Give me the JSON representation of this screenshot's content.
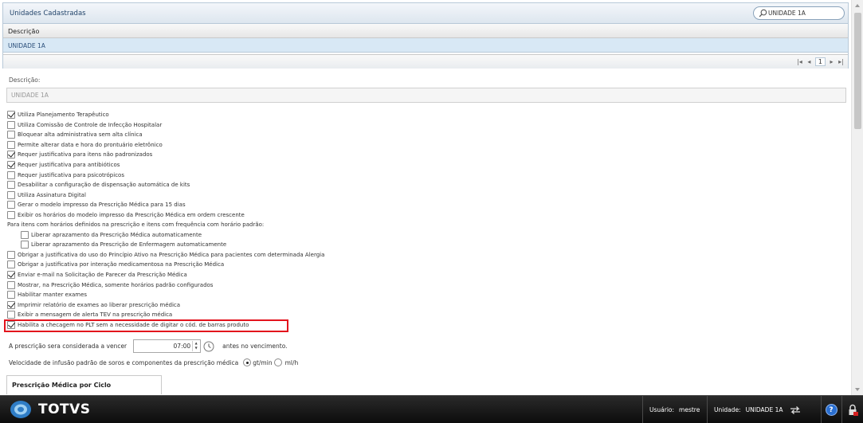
{
  "panel": {
    "title": "Unidades Cadastradas",
    "search_value": "UNIDADE 1A",
    "column_header": "Descrição",
    "rows": [
      "UNIDADE 1A"
    ],
    "pager": {
      "first": "|◂",
      "prev": "◂",
      "page": "1",
      "next": "▸",
      "last": "▸|"
    }
  },
  "form": {
    "descricao_label": "Descrição:",
    "descricao_value": "UNIDADE 1A",
    "options": [
      {
        "label": "Utiliza Planejamento Terapêutico",
        "checked": true
      },
      {
        "label": "Utiliza Comissão de Controle de Infecção Hospitalar",
        "checked": false
      },
      {
        "label": "Bloquear alta administrativa sem alta clínica",
        "checked": false
      },
      {
        "label": "Permite alterar data e hora do prontuário eletrônico",
        "checked": false
      },
      {
        "label": "Requer justificativa para itens não padronizados",
        "checked": true
      },
      {
        "label": "Requer justificativa para antibióticos",
        "checked": true
      },
      {
        "label": "Requer justificativa para psicotrópicos",
        "checked": false
      },
      {
        "label": "Desabilitar a configuração de dispensação automática de kits",
        "checked": false
      },
      {
        "label": "Utiliza Assinatura Digital",
        "checked": false
      },
      {
        "label": "Gerar o modelo impresso da Prescrição Médica para 15 dias",
        "checked": false
      },
      {
        "label": "Exibir os horários do modelo impresso da Prescrição Médica em ordem crescente",
        "checked": false
      },
      {
        "label": "Para itens com horários definidos na prescrição e itens com frequência com horário padrão:",
        "type": "text"
      },
      {
        "label": "Liberar aprazamento da Prescrição Médica automaticamente",
        "checked": false,
        "indent": true
      },
      {
        "label": "Liberar aprazamento da Prescrição de Enfermagem automaticamente",
        "checked": false,
        "indent": true
      },
      {
        "label": "Obrigar a justificativa do uso do Princípio Ativo na Prescrição Médica para pacientes com determinada Alergia",
        "checked": false
      },
      {
        "label": "Obrigar a justificativa por interação medicamentosa na Prescrição Médica",
        "checked": false
      },
      {
        "label": "Enviar e-mail na Solicitação de Parecer da Prescrição Médica",
        "checked": true
      },
      {
        "label": "Mostrar, na Prescrição Médica, somente horários padrão configurados",
        "checked": false
      },
      {
        "label": "Habilitar manter exames",
        "checked": false
      },
      {
        "label": "Imprimir relatório de exames ao liberar prescrição médica",
        "checked": true
      },
      {
        "label": "Exibir a mensagem de alerta TEV na prescrição médica",
        "checked": false
      },
      {
        "label": "Habilita a checagem no PLT sem a necessidade de digitar o cód. de barras produto",
        "checked": true
      }
    ],
    "vencer_label": "A prescrição sera considerada a vencer",
    "vencer_time": "07:00",
    "vencer_suffix": "antes no vencimento.",
    "velocidade_label": "Velocidade de infusão padrão de soros e componentes da prescrição médica",
    "velocidade_options": [
      {
        "label": "gt/min",
        "selected": true
      },
      {
        "label": "ml/h",
        "selected": false
      }
    ],
    "section_tab": "Prescrição Médica por Ciclo"
  },
  "bottombar": {
    "brand": "TOTVS",
    "user_label": "Usuário:",
    "user_value": "mestre",
    "unit_label": "Unidade:",
    "unit_value": "UNIDADE 1A",
    "help": "?"
  },
  "colors": {
    "accent": "#2a6fd1",
    "highlight_border": "#e3141d",
    "selected_row": "#d8e8f5",
    "bottombar": "#111111"
  },
  "icons": [
    "search-icon",
    "clock-icon",
    "swap-icon",
    "help-icon",
    "exit-icon",
    "totvs-logo"
  ]
}
